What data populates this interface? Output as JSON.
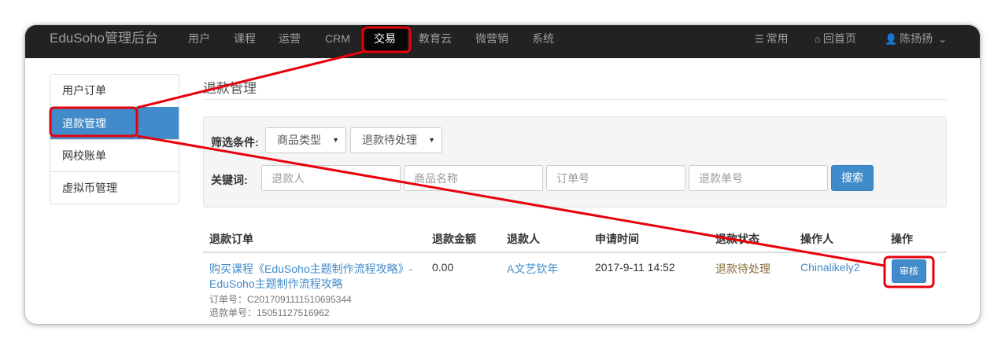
{
  "navbar": {
    "brand": "EduSoho管理后台",
    "items": [
      "用户",
      "课程",
      "运营",
      "CRM",
      "交易",
      "教育云",
      "微营销",
      "系统"
    ],
    "right": {
      "common_label": "常用",
      "home_label": "回首页",
      "user_label": "陈扬扬"
    }
  },
  "sidebar": {
    "items": [
      "用户订单",
      "退款管理",
      "网校账单",
      "虚拟币管理"
    ],
    "active_index": 1
  },
  "page": {
    "title": "退款管理"
  },
  "filter": {
    "condition_label": "筛选条件:",
    "product_type_select": "商品类型",
    "status_select": "退款待处理",
    "keyword_label": "关键词:",
    "placeholders": [
      "退款人",
      "商品名称",
      "订单号",
      "退款单号"
    ],
    "search_button": "搜索"
  },
  "table": {
    "headers": [
      "退款订单",
      "退款金额",
      "退款人",
      "申请时间",
      "退款状态",
      "操作人",
      "操作"
    ],
    "rows": [
      {
        "title_line1": "购买课程《EduSoho主题制作流程攻略》-",
        "title_line2": "EduSoho主题制作流程攻略",
        "order_no": "订单号：C2017091111510695344",
        "refund_no": "退款单号：15051127516962",
        "amount": "0.00",
        "user": "A文艺钦年",
        "time": "2017-9-11 14:52",
        "status": "退款待处理",
        "operator": "Chinalikely2",
        "action": "审核"
      }
    ]
  },
  "colors": {
    "navbar_bg": "#222222",
    "primary": "#428bca",
    "annotation": "#e8000b",
    "status_pending": "#8a6d3b"
  }
}
